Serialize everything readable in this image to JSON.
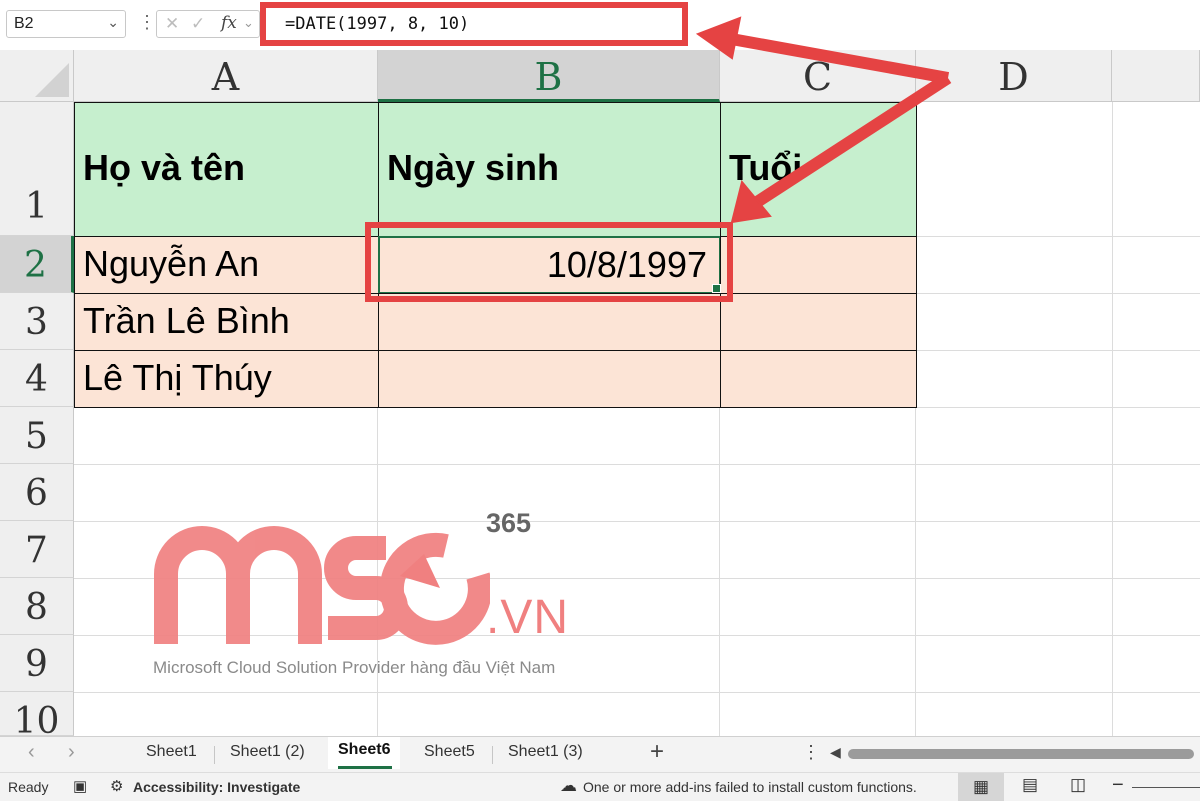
{
  "formula_bar": {
    "name_box": "B2",
    "dropdown_glyph": "⌄",
    "separator_glyph": "⋮",
    "cancel_glyph": "✕",
    "enter_glyph": "✓",
    "fx_label": "fx",
    "formula": "=DATE(1997, 8, 10)"
  },
  "columns": [
    "A",
    "B",
    "C",
    "D",
    ""
  ],
  "rows": [
    "1",
    "2",
    "3",
    "4",
    "5",
    "6",
    "7",
    "8",
    "9",
    "10"
  ],
  "cells": {
    "A1": "Họ và tên",
    "B1": "Ngày sinh",
    "C1": "Tuổi",
    "A2": "Nguyễn An",
    "B2": "10/8/1997",
    "A3": "Trần Lê Bình",
    "A4": "Lê Thị Thúy"
  },
  "watermark": {
    "brand": "MSO",
    "superscript": "365",
    "domain": ".VN",
    "tagline": "Microsoft Cloud Solution Provider hàng đầu Việt Nam"
  },
  "sheet_tabs": {
    "prev_glyph": "‹",
    "next_glyph": "›",
    "tabs": [
      "Sheet1",
      "Sheet1 (2)",
      "Sheet6",
      "Sheet5",
      "Sheet1 (3)"
    ],
    "active": "Sheet6",
    "add_glyph": "+",
    "menu_glyph": "⋮",
    "scroll_glyph": "◀"
  },
  "status_bar": {
    "status": "Ready",
    "macro_icon": "▣",
    "accessibility_icon": "⚙",
    "accessibility": "Accessibility: Investigate",
    "addin_icon": "☁",
    "addin_message": "One or more add-ins failed to install custom functions.",
    "normal_view_icon": "▦",
    "page_layout_icon": "▤",
    "page_break_icon": "◫",
    "zoom_minus": "−"
  },
  "colors": {
    "header_fill": "#c6efce",
    "data_fill": "#fce4d6",
    "highlight": "#e54343",
    "excel_green": "#1e7145",
    "watermark": "#f08080"
  }
}
